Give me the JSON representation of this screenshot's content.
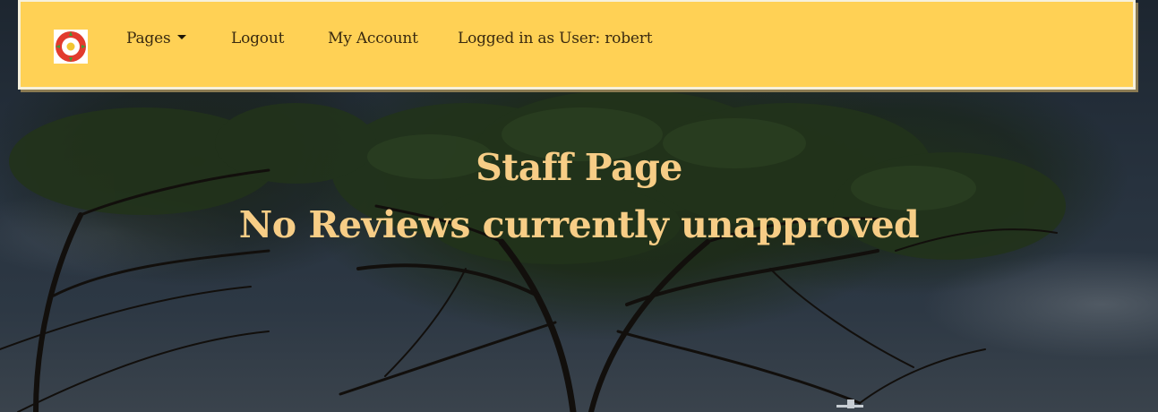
{
  "navbar": {
    "brand_icon": "tudor-rose-icon",
    "items": [
      {
        "label": "Pages",
        "has_dropdown": true
      },
      {
        "label": "Logout"
      },
      {
        "label": "My Account"
      }
    ],
    "user_status": "Logged in as User: robert"
  },
  "main": {
    "title": "Staff Page",
    "message": "No Reviews currently unapproved"
  },
  "colors": {
    "navbar_bg": "#ffd155",
    "nav_text": "#3a2a10",
    "heading_text": "#f7cd86"
  }
}
